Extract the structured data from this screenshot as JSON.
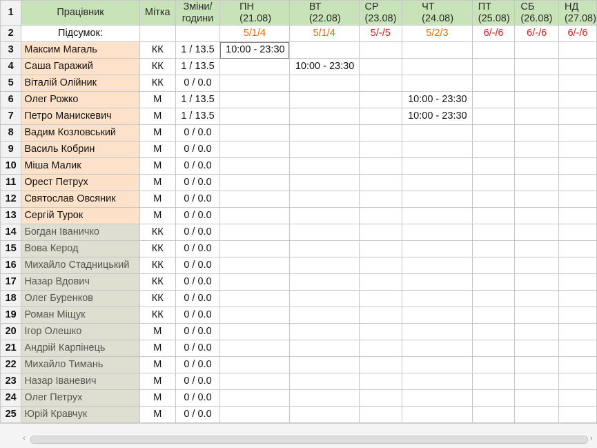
{
  "header": {
    "row_num": "1",
    "name": "Працівник",
    "tag": "Мітка",
    "shifts_line1": "Зміни/",
    "shifts_line2": "години",
    "days": [
      {
        "d": "ПН",
        "date": "(21.08)"
      },
      {
        "d": "ВТ",
        "date": "(22.08)"
      },
      {
        "d": "СР",
        "date": "(23.08)"
      },
      {
        "d": "ЧТ",
        "date": "(24.08)"
      },
      {
        "d": "ПТ",
        "date": "(25.08)"
      },
      {
        "d": "СБ",
        "date": "(26.08)"
      },
      {
        "d": "НД",
        "date": "(27.08)"
      }
    ]
  },
  "summary": {
    "row_num": "2",
    "label": "Підсумок:",
    "values": [
      "5/1/4",
      "5/1/4",
      "5/-/5",
      "5/2/3",
      "6/-/6",
      "6/-/6",
      "6/-/6"
    ],
    "colors": [
      "#e46a0b",
      "#e46a0b",
      "#e0141b",
      "#e46a0b",
      "#e0141b",
      "#e0141b",
      "#e0141b"
    ]
  },
  "rows": [
    {
      "n": "3",
      "name": "Максим Магаль",
      "tag": "КК",
      "shifts": "1 / 13.5",
      "group": "peach",
      "days": [
        "10:00 - 23:30",
        "",
        "",
        "",
        "",
        "",
        ""
      ]
    },
    {
      "n": "4",
      "name": "Саша Гаражий",
      "tag": "КК",
      "shifts": "1 / 13.5",
      "group": "peach",
      "days": [
        "",
        "10:00 - 23:30",
        "",
        "",
        "",
        "",
        ""
      ]
    },
    {
      "n": "5",
      "name": "Віталій Олійник",
      "tag": "КК",
      "shifts": "0 / 0.0",
      "group": "peach",
      "days": [
        "",
        "",
        "",
        "",
        "",
        "",
        ""
      ]
    },
    {
      "n": "6",
      "name": "Олег Рожко",
      "tag": "М",
      "shifts": "1 / 13.5",
      "group": "peach",
      "days": [
        "",
        "",
        "",
        "10:00 - 23:30",
        "",
        "",
        ""
      ]
    },
    {
      "n": "7",
      "name": "Петро Манискевич",
      "tag": "М",
      "shifts": "1 / 13.5",
      "group": "peach",
      "days": [
        "",
        "",
        "",
        "10:00 - 23:30",
        "",
        "",
        ""
      ]
    },
    {
      "n": "8",
      "name": "Вадим Козловський",
      "tag": "М",
      "shifts": "0 / 0.0",
      "group": "peach",
      "days": [
        "",
        "",
        "",
        "",
        "",
        "",
        ""
      ]
    },
    {
      "n": "9",
      "name": "Василь Кобрин",
      "tag": "М",
      "shifts": "0 / 0.0",
      "group": "peach",
      "days": [
        "",
        "",
        "",
        "",
        "",
        "",
        ""
      ]
    },
    {
      "n": "10",
      "name": "Міша Малик",
      "tag": "М",
      "shifts": "0 / 0.0",
      "group": "peach",
      "days": [
        "",
        "",
        "",
        "",
        "",
        "",
        ""
      ]
    },
    {
      "n": "11",
      "name": "Орест Петрух",
      "tag": "М",
      "shifts": "0 / 0.0",
      "group": "peach",
      "days": [
        "",
        "",
        "",
        "",
        "",
        "",
        ""
      ]
    },
    {
      "n": "12",
      "name": "Святослав Овсяник",
      "tag": "М",
      "shifts": "0 / 0.0",
      "group": "peach",
      "days": [
        "",
        "",
        "",
        "",
        "",
        "",
        ""
      ]
    },
    {
      "n": "13",
      "name": "Сергій Турок",
      "tag": "М",
      "shifts": "0 / 0.0",
      "group": "peach",
      "days": [
        "",
        "",
        "",
        "",
        "",
        "",
        ""
      ]
    },
    {
      "n": "14",
      "name": "Богдан Іваничко",
      "tag": "КК",
      "shifts": "0 / 0.0",
      "group": "grey",
      "days": [
        "",
        "",
        "",
        "",
        "",
        "",
        ""
      ]
    },
    {
      "n": "15",
      "name": "Вова Керод",
      "tag": "КК",
      "shifts": "0 / 0.0",
      "group": "grey",
      "days": [
        "",
        "",
        "",
        "",
        "",
        "",
        ""
      ]
    },
    {
      "n": "16",
      "name": "Михайло Стадницький",
      "tag": "КК",
      "shifts": "0 / 0.0",
      "group": "grey",
      "days": [
        "",
        "",
        "",
        "",
        "",
        "",
        ""
      ]
    },
    {
      "n": "17",
      "name": "Назар Вдович",
      "tag": "КК",
      "shifts": "0 / 0.0",
      "group": "grey",
      "days": [
        "",
        "",
        "",
        "",
        "",
        "",
        ""
      ]
    },
    {
      "n": "18",
      "name": "Олег Буренков",
      "tag": "КК",
      "shifts": "0 / 0.0",
      "group": "grey",
      "days": [
        "",
        "",
        "",
        "",
        "",
        "",
        ""
      ]
    },
    {
      "n": "19",
      "name": "Роман Міщук",
      "tag": "КК",
      "shifts": "0 / 0.0",
      "group": "grey",
      "days": [
        "",
        "",
        "",
        "",
        "",
        "",
        ""
      ]
    },
    {
      "n": "20",
      "name": "Ігор Олешко",
      "tag": "М",
      "shifts": "0 / 0.0",
      "group": "grey",
      "days": [
        "",
        "",
        "",
        "",
        "",
        "",
        ""
      ]
    },
    {
      "n": "21",
      "name": "Андрій Карпінець",
      "tag": "М",
      "shifts": "0 / 0.0",
      "group": "grey",
      "days": [
        "",
        "",
        "",
        "",
        "",
        "",
        ""
      ]
    },
    {
      "n": "22",
      "name": "Михайло Тимань",
      "tag": "М",
      "shifts": "0 / 0.0",
      "group": "grey",
      "days": [
        "",
        "",
        "",
        "",
        "",
        "",
        ""
      ]
    },
    {
      "n": "23",
      "name": "Назар Іваневич",
      "tag": "М",
      "shifts": "0 / 0.0",
      "group": "grey",
      "days": [
        "",
        "",
        "",
        "",
        "",
        "",
        ""
      ]
    },
    {
      "n": "24",
      "name": "Олег Петрух",
      "tag": "М",
      "shifts": "0 / 0.0",
      "group": "grey",
      "days": [
        "",
        "",
        "",
        "",
        "",
        "",
        ""
      ]
    },
    {
      "n": "25",
      "name": "Юрій Кравчук",
      "tag": "М",
      "shifts": "0 / 0.0",
      "group": "grey",
      "days": [
        "",
        "",
        "",
        "",
        "",
        "",
        ""
      ]
    }
  ],
  "scrollbar": {
    "left_arrow": "‹",
    "right_arrow": "›"
  }
}
